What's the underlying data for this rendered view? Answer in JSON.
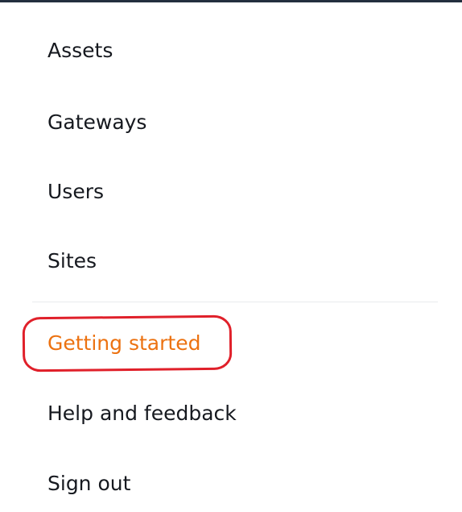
{
  "nav": {
    "items": [
      {
        "label": "Assets"
      },
      {
        "label": "Gateways"
      },
      {
        "label": "Users"
      },
      {
        "label": "Sites"
      }
    ],
    "footer_items": [
      {
        "label": "Getting started"
      },
      {
        "label": "Help and feedback"
      },
      {
        "label": "Sign out"
      }
    ]
  },
  "colors": {
    "text": "#16191f",
    "active": "#ec7211",
    "annotation": "#e0202a",
    "divider": "#e9ebed",
    "top_bar": "#232f3e"
  }
}
